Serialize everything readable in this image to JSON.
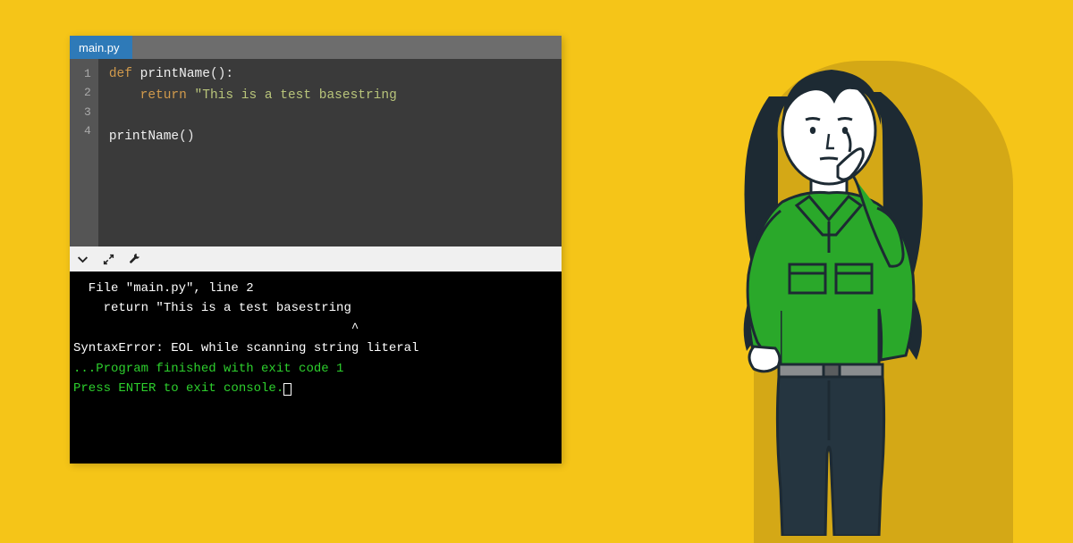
{
  "tab": {
    "filename": "main.py"
  },
  "code": {
    "lines": [
      "1",
      "2",
      "3",
      "4"
    ],
    "line1": {
      "def": "def",
      "name": " printName",
      "paren": "():"
    },
    "line2": {
      "indent": "    ",
      "return": "return",
      "space": " ",
      "string": "\"This is a test basestring"
    },
    "line3": "",
    "line4": {
      "name": "printName",
      "paren": "()"
    }
  },
  "terminal": {
    "l1": "  File \"main.py\", line 2",
    "l2": "    return \"This is a test basestring",
    "l3": "                                     ^",
    "l4": "SyntaxError: EOL while scanning string literal",
    "l5": "",
    "l6": "",
    "l7": "...Program finished with exit code 1",
    "l8": "Press ENTER to exit console."
  },
  "icons": {
    "chevron": "chevron-down-icon",
    "expand": "expand-icon",
    "wrench": "wrench-icon"
  }
}
